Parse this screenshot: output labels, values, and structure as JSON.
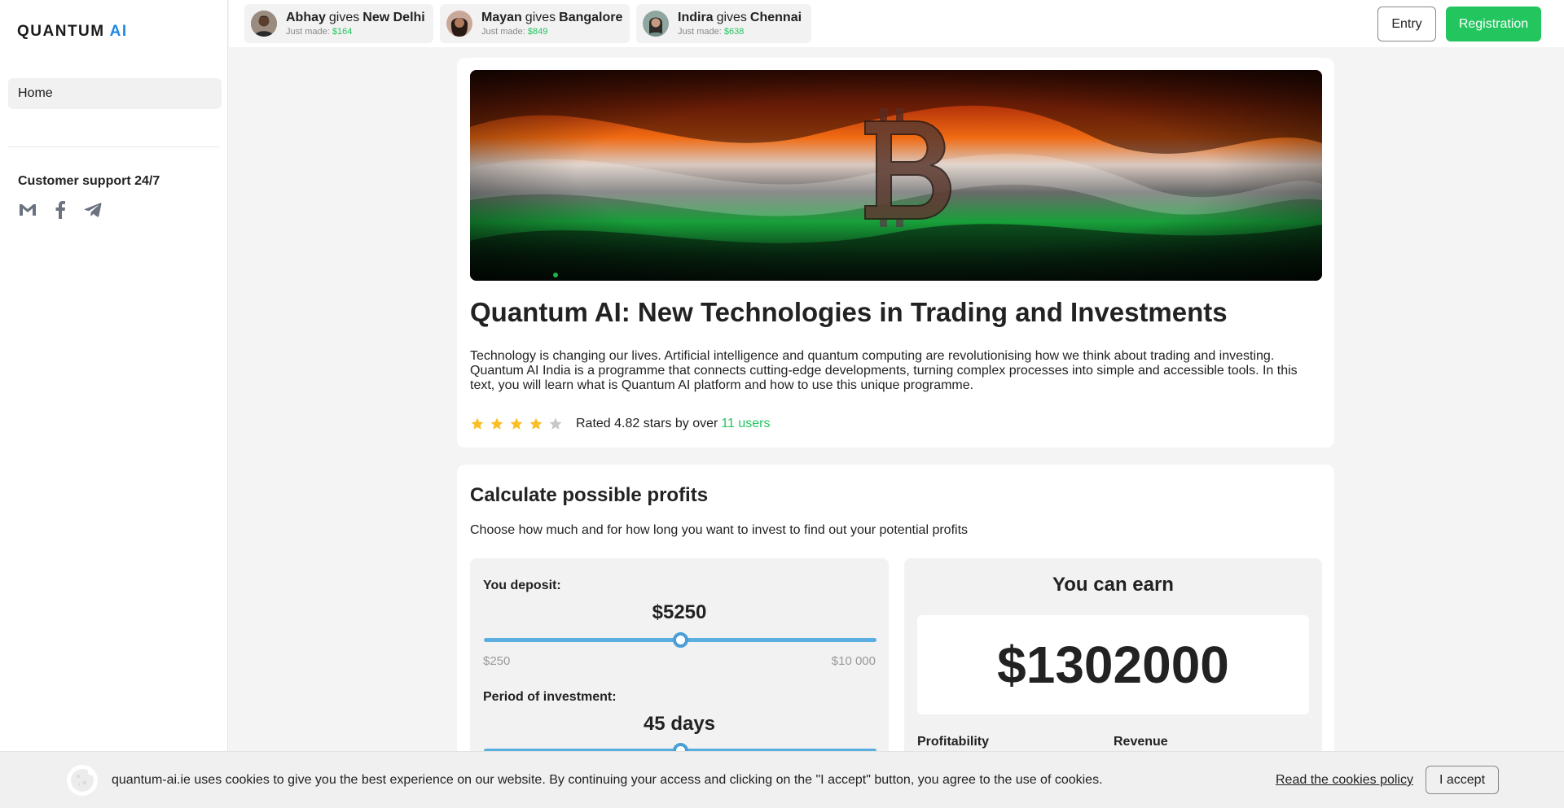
{
  "brand": {
    "logo_main": "QUANTUM",
    "logo_accent": "AI",
    "accent_color": "#1e88e5",
    "brand_green": "#22c55e"
  },
  "sidebar": {
    "home_label": "Home",
    "support_title": "Customer support 24/7",
    "social_icons": [
      "gmail-icon",
      "facebook-icon",
      "telegram-icon"
    ]
  },
  "notifications": [
    {
      "name": "Abhay",
      "gives": "gives",
      "city": "New Delhi",
      "made_label": "Just made:",
      "amount": "$164"
    },
    {
      "name": "Mayan",
      "gives": "gives",
      "city": "Bangalore",
      "made_label": "Just made:",
      "amount": "$849"
    },
    {
      "name": "Indira",
      "gives": "gives",
      "city": "Chennai",
      "made_label": "Just made:",
      "amount": "$638"
    }
  ],
  "header": {
    "entry_label": "Entry",
    "registration_label": "Registration"
  },
  "article": {
    "title": "Quantum AI: New Technologies in Trading and Investments",
    "description": "Technology is changing our lives. Artificial intelligence and quantum computing are revolutionising how we think about trading and investing. Quantum AI India is a programme that connects cutting-edge developments, turning complex processes into simple and accessible tools. In this text, you will learn what is Quantum AI platform and how to use this unique programme.",
    "rating": {
      "stars_filled": 4,
      "stars_total": 5,
      "text": "Rated 4.82 stars by over",
      "users": "11 users"
    }
  },
  "calculator": {
    "title": "Calculate possible profits",
    "subtitle": "Choose how much and for how long you want to invest to find out your potential profits",
    "deposit_label": "You deposit:",
    "deposit_value": "$5250",
    "deposit_fraction": 0.5,
    "deposit_min": "$250",
    "deposit_max": "$10 000",
    "period_label": "Period of investment:",
    "period_value": "45 days",
    "period_fraction": 0.5,
    "earn_title": "You can earn",
    "earn_value": "$1302000",
    "profitability_label": "Profitability",
    "revenue_label": "Revenue"
  },
  "cookie": {
    "text": "quantum-ai.ie uses cookies to give you the best experience on our website. By continuing your access and clicking on the \"I accept\" button, you agree to the use of cookies.",
    "policy_link": "Read the cookies policy",
    "accept_label": "I accept"
  }
}
